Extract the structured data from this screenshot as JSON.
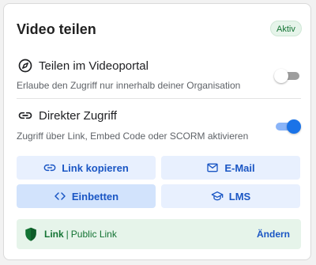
{
  "header": {
    "title": "Video teilen",
    "badge": "Aktiv"
  },
  "sections": [
    {
      "icon": "compass-icon",
      "title": "Teilen im Videoportal",
      "description": "Erlaube den Zugriff nur innerhalb deiner Organisation",
      "enabled": false
    },
    {
      "icon": "link-icon",
      "title": "Direkter Zugriff",
      "description": "Zugriff über Link, Embed Code oder SCORM aktivieren",
      "enabled": true
    }
  ],
  "buttons": [
    {
      "label": "Link kopieren",
      "icon": "link-icon"
    },
    {
      "label": "E-Mail",
      "icon": "mail-icon"
    },
    {
      "label": "Einbetten",
      "icon": "code-icon",
      "active": true
    },
    {
      "label": "LMS",
      "icon": "graduation-cap-icon"
    }
  ],
  "link_status": {
    "icon": "shield-icon",
    "label": "Link",
    "separator": "|",
    "value": "Public Link",
    "action": "Ändern"
  },
  "colors": {
    "accent": "#1a73e8",
    "button_bg": "#e8f0fe",
    "badge_bg": "#e6f4ea",
    "badge_text": "#137333"
  }
}
